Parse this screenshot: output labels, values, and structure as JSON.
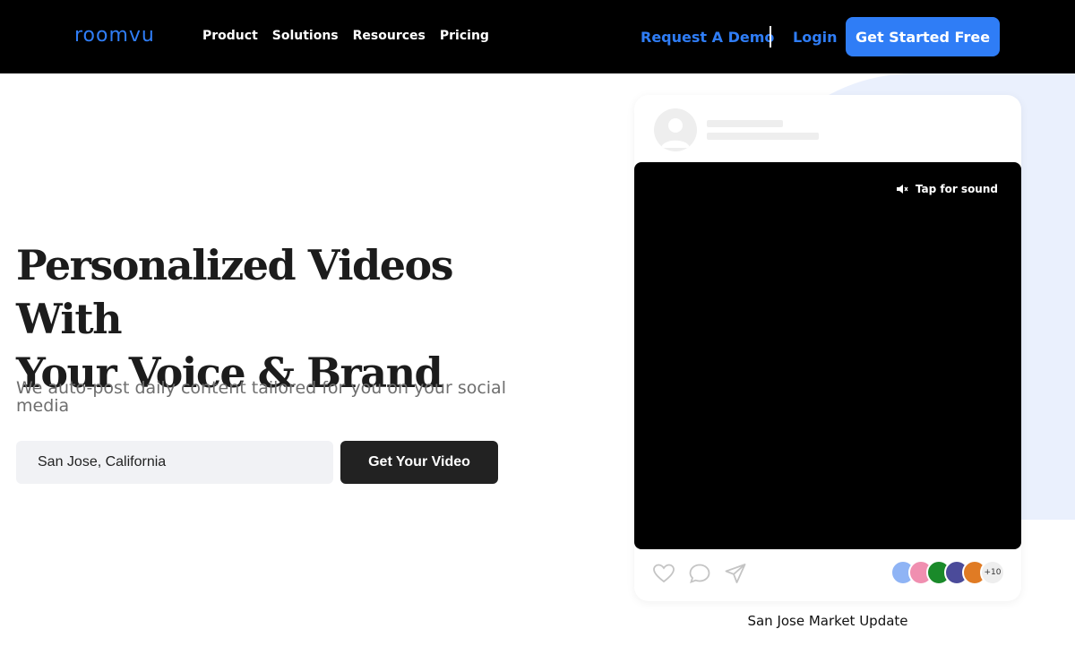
{
  "header": {
    "logo_text": "roomvu",
    "nav": [
      "Product",
      "Solutions",
      "Resources",
      "Pricing"
    ],
    "demo_label": "Request A Demo",
    "login_label": "Login",
    "cta_label": "Get Started Free"
  },
  "hero": {
    "headline_line1": "Personalized Videos With",
    "headline_line2": "Your Voice & Brand",
    "subtext": "We auto-post daily content tailored for you on your social media",
    "location_value": "San Jose, California",
    "cta_label": "Get Your Video"
  },
  "preview": {
    "sound_label": "Tap for sound",
    "viewer_more": "+10",
    "caption": "San Jose Market Update",
    "viewer_colors": [
      "#8fb4f5",
      "#f08fb0",
      "#1a8a2a",
      "#4b4b9a",
      "#e07b24"
    ]
  },
  "colors": {
    "accent": "#2f7df6",
    "dark_button": "#222222"
  }
}
